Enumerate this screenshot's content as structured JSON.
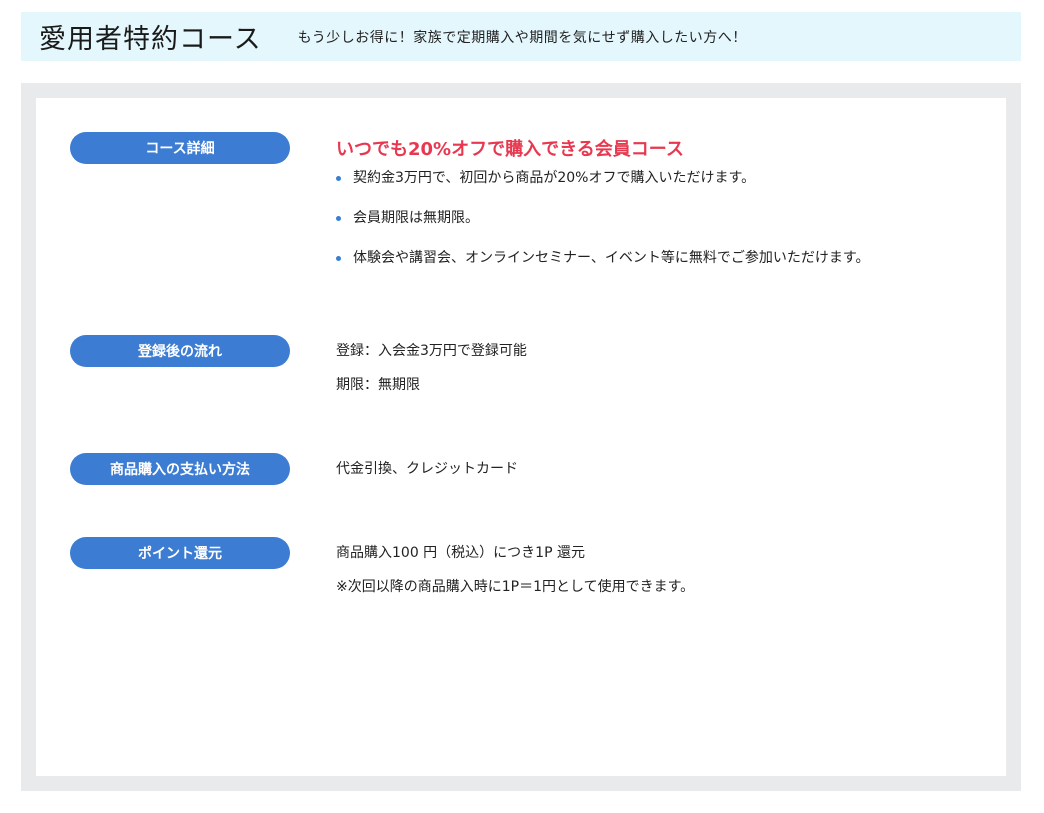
{
  "header": {
    "title": "愛用者特約コース",
    "subtitle": "もう少しお得に！家族で定期購入や期間を気にせず購入したい方へ！"
  },
  "sections": [
    {
      "label": "コース詳細",
      "highlight": "いつでも20%オフで購入できる会員コース",
      "bullets": [
        "契約金3万円で、初回から商品が20%オフで購入いただけます。",
        "会員期限は無期限。",
        "体験会や講習会、オンラインセミナー、イベント等に無料でご参加いただけます。"
      ]
    },
    {
      "label": "登録後の流れ",
      "lines": [
        "登録：入会金3万円で登録可能",
        "期限：無期限"
      ]
    },
    {
      "label": "商品購入の支払い方法",
      "lines": [
        "代金引換、クレジットカード"
      ]
    },
    {
      "label": "ポイント還元",
      "lines": [
        "商品購入100 円（税込）につき1P 還元",
        "※次回以降の商品購入時に1P＝1円として使用できます。"
      ]
    }
  ],
  "colors": {
    "accent": "#3c7dd3",
    "highlight": "#e83850",
    "header_bg": "#e4f7fd",
    "panel_bg": "#e9eaec"
  }
}
